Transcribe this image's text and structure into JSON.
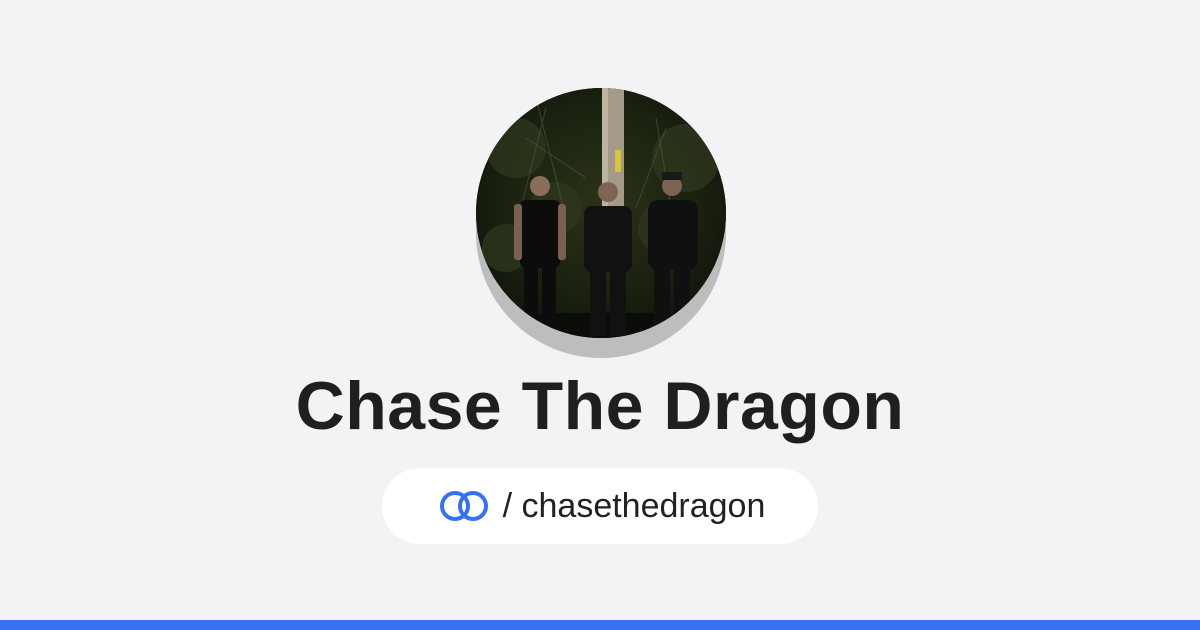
{
  "profile": {
    "name": "Chase The Dragon",
    "handle": "/ chasethedragon",
    "avatar_icon": "band-photo-avatar",
    "link_icon": "linked-rings-icon"
  },
  "colors": {
    "background": "#f3f3f5",
    "accent": "#3871f0",
    "title": "#1f1f22",
    "pill": "#ffffff"
  }
}
